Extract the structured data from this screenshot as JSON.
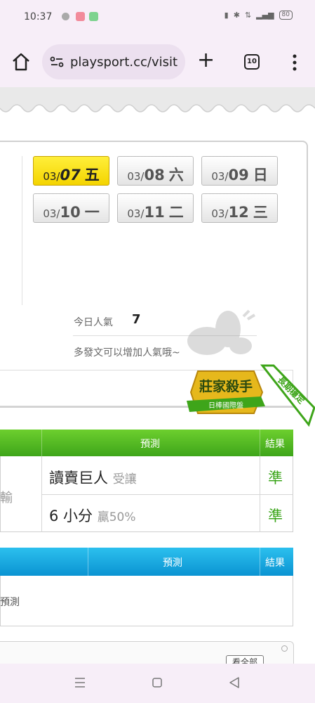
{
  "status_bar": {
    "time": "10:37",
    "battery": "80"
  },
  "browser": {
    "url": "playsport.cc/visit",
    "tab_count": "10"
  },
  "dates": [
    {
      "prefix": "03/",
      "day": "07",
      "weekday": "五",
      "active": true
    },
    {
      "prefix": "03/",
      "day": "08",
      "weekday": "六",
      "active": false
    },
    {
      "prefix": "03/",
      "day": "09",
      "weekday": "日",
      "active": false
    },
    {
      "prefix": "03/",
      "day": "10",
      "weekday": "一",
      "active": false
    },
    {
      "prefix": "03/",
      "day": "11",
      "weekday": "二",
      "active": false
    },
    {
      "prefix": "03/",
      "day": "12",
      "weekday": "三",
      "active": false
    }
  ],
  "popularity": {
    "label": "今日人氣",
    "value": "7",
    "tip": "多發文可以增加人氣哦~"
  },
  "badge": {
    "main": "莊家殺手",
    "sub": "日棒國際盤",
    "ribbon": "長期穩定"
  },
  "table1": {
    "headers": {
      "prediction": "預測",
      "result": "結果"
    },
    "left_text": "輸",
    "rows": [
      {
        "pick": "讀賣巨人",
        "type": "受讓",
        "result": "準"
      },
      {
        "pick": "6 小分",
        "type": "贏50%",
        "result": "準"
      }
    ]
  },
  "table2": {
    "headers": {
      "prediction": "預測",
      "result": "結果"
    },
    "empty_text": "預測"
  },
  "bottom": {
    "see_all": "看全部"
  },
  "colors": {
    "green": "#3ea51a",
    "blue": "#0a93d2",
    "yellow": "#f4d400",
    "browser_bg": "#f7eef8"
  }
}
